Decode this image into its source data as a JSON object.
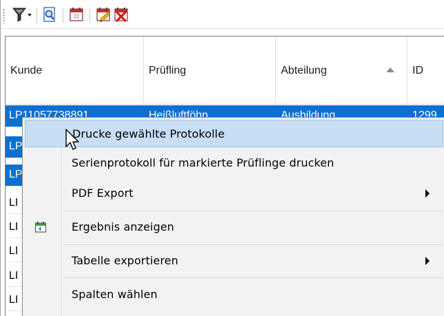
{
  "toolbar": {
    "buttons": [
      {
        "icon": "filter-dropdown-icon"
      },
      {
        "icon": "preview-icon"
      },
      {
        "icon": "calendar-icon"
      },
      {
        "icon": "edit-calendar-icon"
      },
      {
        "icon": "delete-calendar-icon"
      }
    ]
  },
  "grid": {
    "columns": [
      {
        "label": "Kunde"
      },
      {
        "label": "Prüfling"
      },
      {
        "label": "Abteilung",
        "sorted": "ascending"
      },
      {
        "label": "ID"
      }
    ],
    "rows": [
      {
        "kunde": "LP11057738891",
        "pruefling": "Heißluftföhn",
        "abteilung": "Ausbildung",
        "id": "1299",
        "selected": true
      },
      {
        "kunde": "LP",
        "selected": true
      },
      {
        "kunde": "LP",
        "selected": true
      },
      {
        "kunde": "LI",
        "selected": false
      },
      {
        "kunde": "LI",
        "selected": false
      },
      {
        "kunde": "LI",
        "selected": false
      },
      {
        "kunde": "LI",
        "selected": false
      },
      {
        "kunde": "LI",
        "selected": false
      }
    ],
    "selection_color": "#0f6fd1"
  },
  "context_menu": {
    "items": [
      {
        "label": "Drucke gewählte Protokolle",
        "hover": true
      },
      {
        "label": "Serienprotokoll für markierte Prüflinge drucken"
      },
      {
        "label": "PDF Export",
        "submenu": true
      },
      {
        "label": "Ergebnis anzeigen",
        "icon": "result-calendar-icon"
      },
      {
        "label": "Tabelle exportieren",
        "submenu": true
      },
      {
        "label": "Spalten wählen"
      }
    ],
    "hover_color": "#c7def5"
  }
}
